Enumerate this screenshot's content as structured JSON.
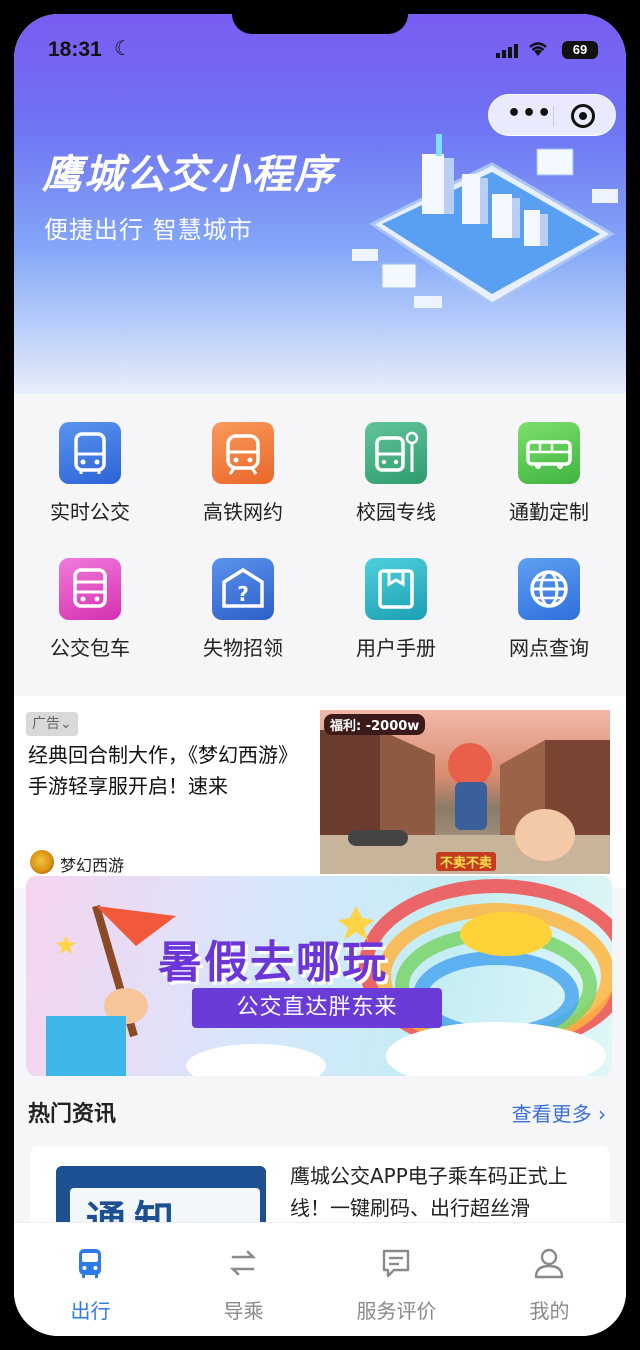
{
  "status_bar": {
    "time": "18:31",
    "battery": "69"
  },
  "capsule": {
    "more_label": "•••"
  },
  "hero": {
    "title": "鹰城公交小程序",
    "subtitle": "便捷出行 智慧城市"
  },
  "services": [
    {
      "label": "实时公交",
      "icon": "bus-front-icon",
      "color": "#3d7be3"
    },
    {
      "label": "高铁网约",
      "icon": "train-icon",
      "color": "#f07a3a"
    },
    {
      "label": "校园专线",
      "icon": "campus-bus-icon",
      "color": "#3fae7b"
    },
    {
      "label": "通勤定制",
      "icon": "commute-bus-icon",
      "color": "#56c85a"
    },
    {
      "label": "公交包车",
      "icon": "charter-bus-icon",
      "color": "#e24cc6"
    },
    {
      "label": "失物招领",
      "icon": "lost-found-icon",
      "color": "#3c74d8"
    },
    {
      "label": "用户手册",
      "icon": "manual-icon",
      "color": "#23b5c4"
    },
    {
      "label": "网点查询",
      "icon": "globe-icon",
      "color": "#3f83e0"
    }
  ],
  "ad": {
    "tag": "广告⌄",
    "text": "经典回合制大作，《梦幻西游》手游轻享服开启！速来",
    "brand": "梦幻西游",
    "image_banner": "福利: -2000w",
    "image_caption": "不卖不卖"
  },
  "banner": {
    "headline": "暑假去哪玩",
    "pill": "公交直达胖东来"
  },
  "news": {
    "section_title": "热门资讯",
    "more_label": "查看更多 ›",
    "items": [
      {
        "thumb_word": "通知",
        "headline": "鹰城公交APP电子乘车码正式上线！一键刷码、出行超丝滑"
      }
    ]
  },
  "tabbar": [
    {
      "label": "出行",
      "icon": "bus-tab-icon",
      "active": true
    },
    {
      "label": "导乘",
      "icon": "transfer-icon",
      "active": false
    },
    {
      "label": "服务评价",
      "icon": "comment-icon",
      "active": false
    },
    {
      "label": "我的",
      "icon": "user-icon",
      "active": false
    }
  ],
  "colors": {
    "accent": "#2f7be5",
    "hero_top": "#7a5cf2",
    "banner_purple": "#6a3bd7"
  }
}
